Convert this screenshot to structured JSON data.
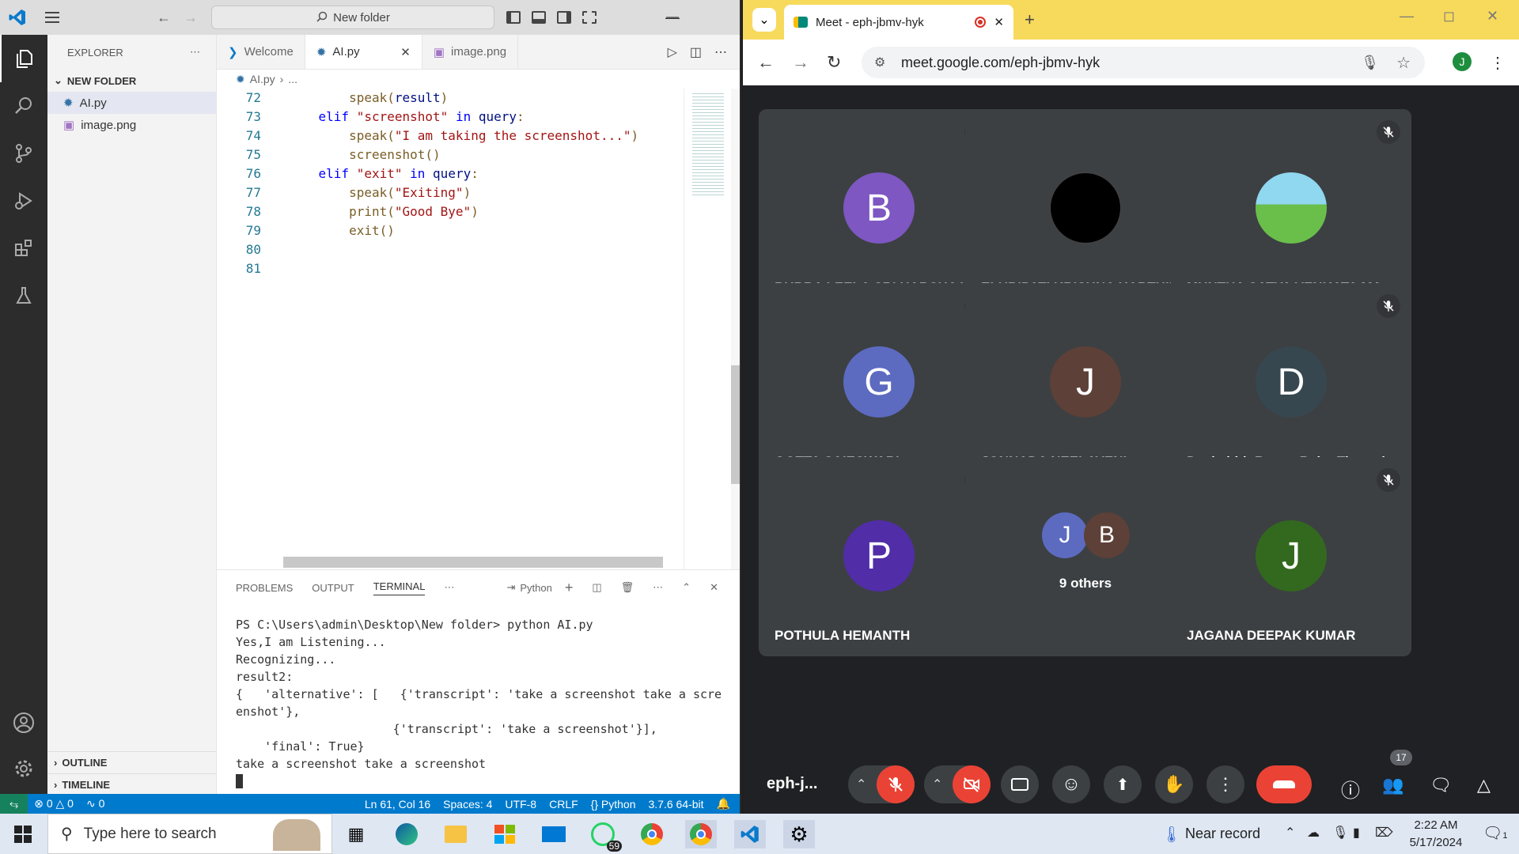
{
  "vscode": {
    "search": "New folder",
    "tabs": [
      "Welcome",
      "AI.py",
      "image.png"
    ],
    "breadcrumb": [
      "AI.py",
      "..."
    ],
    "explorer": {
      "title": "EXPLORER",
      "folder": "NEW FOLDER",
      "files": [
        "AI.py",
        "image.png"
      ],
      "outline": "OUTLINE",
      "timeline": "TIMELINE"
    },
    "code": [
      {
        "n": "72",
        "t": "        speak(result)"
      },
      {
        "n": "73",
        "t": "    elif \"screenshot\" in query:"
      },
      {
        "n": "74",
        "t": "        speak(\"I am taking the screenshot...\")"
      },
      {
        "n": "75",
        "t": "        screenshot()"
      },
      {
        "n": "76",
        "t": "    elif \"exit\" in query:"
      },
      {
        "n": "77",
        "t": "        speak(\"Exiting\")"
      },
      {
        "n": "78",
        "t": "        print(\"Good Bye\")"
      },
      {
        "n": "79",
        "t": "        exit()"
      },
      {
        "n": "80",
        "t": ""
      },
      {
        "n": "81",
        "t": ""
      }
    ],
    "panel_tabs": [
      "PROBLEMS",
      "OUTPUT",
      "TERMINAL"
    ],
    "panel_python": "Python",
    "terminal": [
      "PS C:\\Users\\admin\\Desktop\\New folder> python AI.py",
      "Yes,I am Listening...",
      "Recognizing...",
      "result2:",
      "{   'alternative': [   {'transcript': 'take a screenshot take a scre",
      "enshot'},",
      "                      {'transcript': 'take a screenshot'}],",
      "    'final': True}",
      "take a screenshot take a screenshot"
    ],
    "status": {
      "errors": "0",
      "warnings": "0",
      "ports": "0",
      "position": "Ln 61, Col 16",
      "spaces": "Spaces: 4",
      "encoding": "UTF-8",
      "eol": "CRLF",
      "language": "Python",
      "interpreter": "3.7.6 64-bit"
    }
  },
  "chrome": {
    "tab_title": "Meet - eph-jbmv-hyk",
    "url": "meet.google.com/eph-jbmv-hyk",
    "profile": "J"
  },
  "meet": {
    "participants": [
      {
        "initial": "B",
        "name": "BURRA LEELA SRI HARSHA VA...",
        "color": "#7e57c2"
      },
      {
        "initial": "",
        "name": "ELURIPATI KRISHNA KARTHIK",
        "color": "#000000"
      },
      {
        "initial": "",
        "name": "MUNTHA SATYA VENKATA MA...",
        "color": "#4fc3a1"
      },
      {
        "initial": "G",
        "name": "GOTTA SAIESWARI",
        "color": "#5c6bc0"
      },
      {
        "initial": "J",
        "name": "JONNADA NEELAVENI",
        "color": "#5d4037"
      },
      {
        "initial": "D",
        "name": "Deekshith Ranga Babu Tirumala",
        "color": "#37474f"
      },
      {
        "initial": "P",
        "name": "POTHULA HEMANTH",
        "color": "#512da8"
      },
      {
        "initial": "",
        "name": "9 others",
        "color": "#3c4043"
      },
      {
        "initial": "J",
        "name": "JAGANA DEEPAK KUMAR",
        "color": "#33691e"
      }
    ],
    "others_avatars": [
      "J",
      "B"
    ],
    "meeting_code": "eph-j...",
    "people_count": "17"
  },
  "taskbar": {
    "search_placeholder": "Type here to search",
    "whatsapp_badge": "59",
    "weather": "Near record",
    "time": "2:22 AM",
    "date": "5/17/2024",
    "notif": "1"
  }
}
